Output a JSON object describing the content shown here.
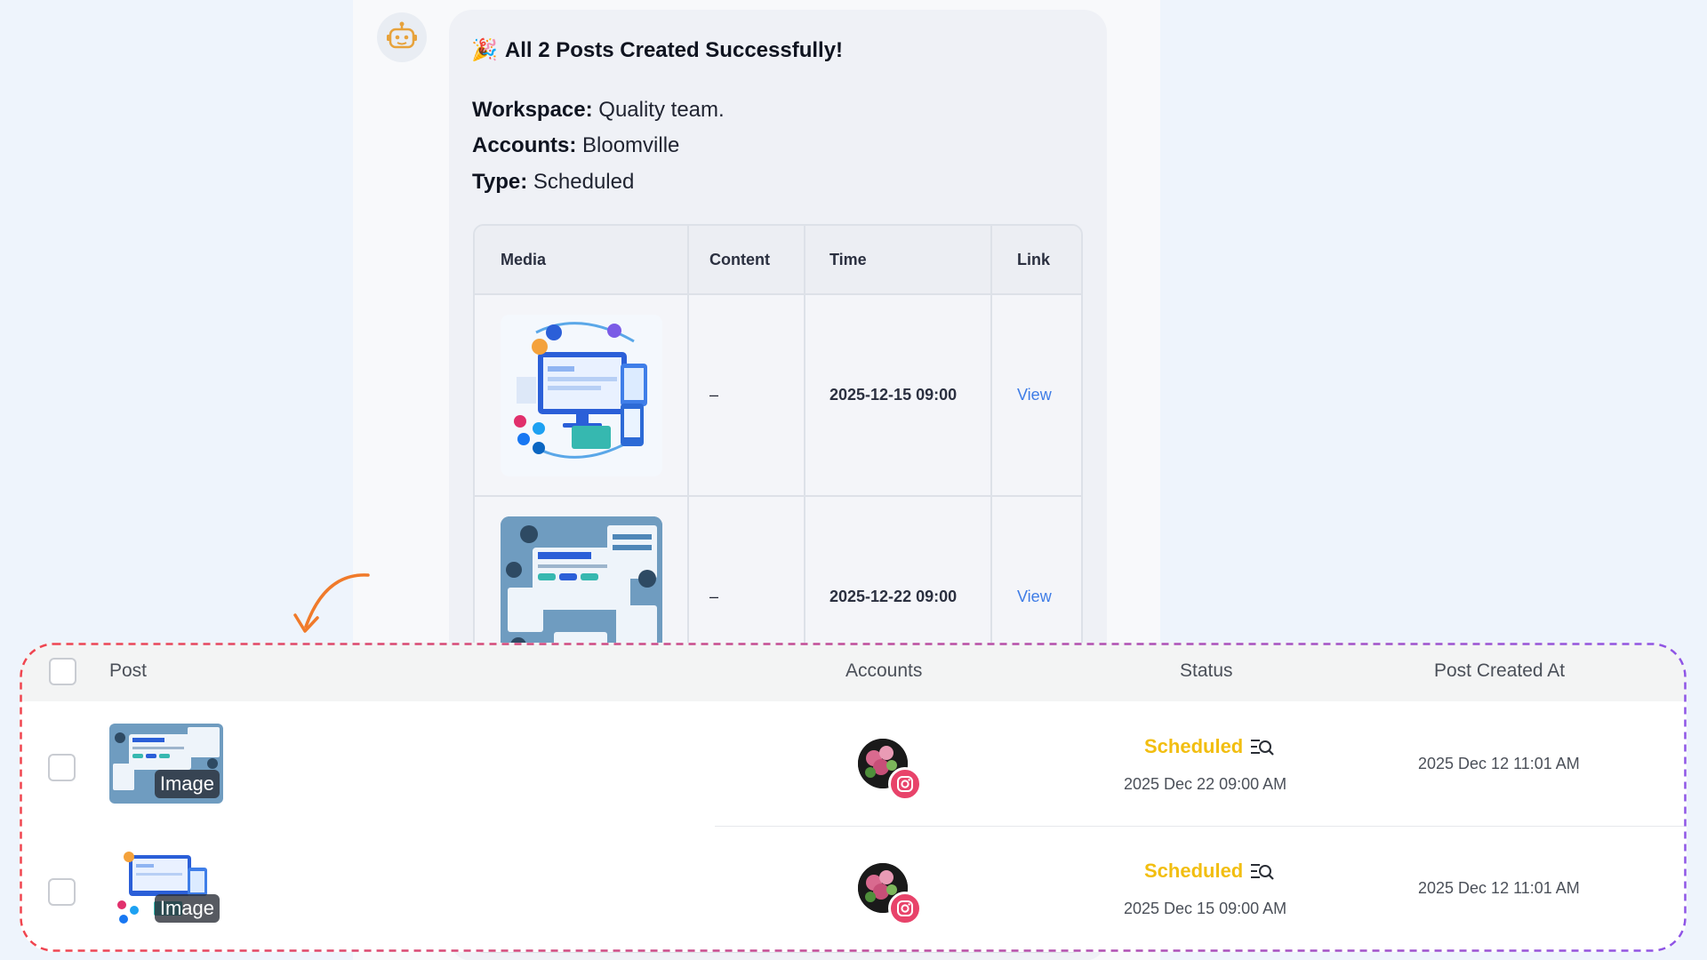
{
  "chat": {
    "title_emoji": "🎉",
    "title": "All 2 Posts Created Successfully!",
    "workspace_label": "Workspace:",
    "workspace_value": "Quality team.",
    "accounts_label": "Accounts:",
    "accounts_value": "Bloomville",
    "type_label": "Type:",
    "type_value": "Scheduled",
    "table": {
      "headers": [
        "Media",
        "Content",
        "Time",
        "Link"
      ],
      "rows": [
        {
          "content": "–",
          "time": "2025-12-15 09:00",
          "link": "View"
        },
        {
          "content": "–",
          "time": "2025-12-22 09:00",
          "link": "View"
        }
      ]
    }
  },
  "posts_list": {
    "headers": {
      "post": "Post",
      "accounts": "Accounts",
      "status": "Status",
      "created": "Post Created At"
    },
    "rows": [
      {
        "media_badge": "Image",
        "status": "Scheduled",
        "scheduled_time": "2025 Dec 22 09:00 AM",
        "created_at": "2025 Dec 12 11:01 AM"
      },
      {
        "media_badge": "Image",
        "status": "Scheduled",
        "scheduled_time": "2025 Dec 15 09:00 AM",
        "created_at": "2025 Dec 12 11:01 AM"
      }
    ]
  },
  "colors": {
    "status_scheduled": "#f2be10",
    "link": "#3e7ce6",
    "instagram": "#e8436a",
    "arrow": "#f07a2a",
    "dash_start": "#f0454f",
    "dash_end": "#8e55e6"
  },
  "icons": [
    "robot-icon",
    "party-popper-icon",
    "instagram-icon",
    "search-list-icon",
    "curved-arrow-icon"
  ]
}
